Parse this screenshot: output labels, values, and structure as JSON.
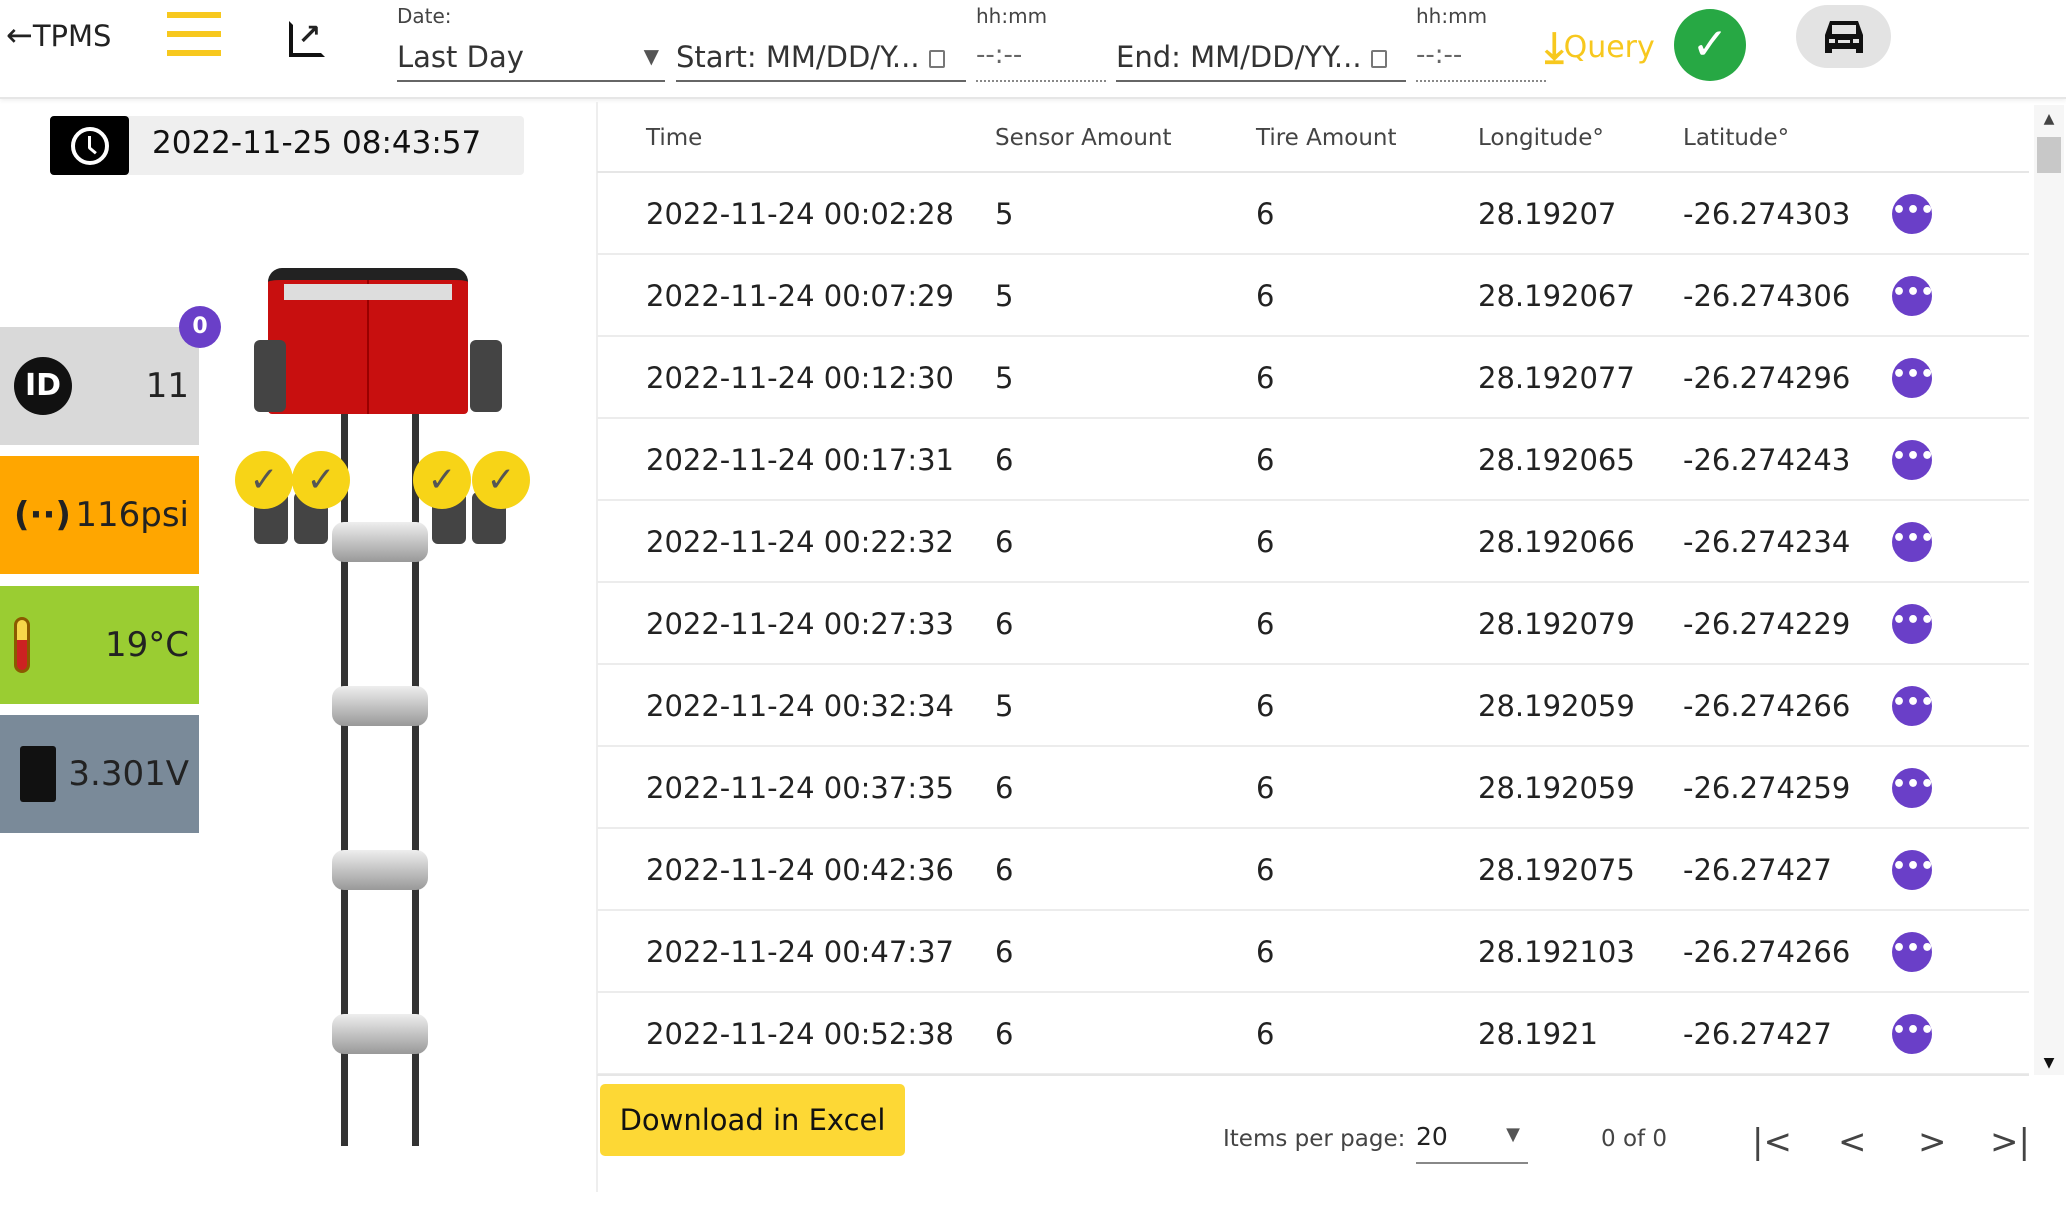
{
  "header": {
    "back_label": "TPMS",
    "date_label": "Date:",
    "date_value": "Last Day",
    "start_placeholder": "Start: MM/DD/Y...",
    "end_placeholder": "End: MM/DD/YY...",
    "time_label_start": "hh:mm",
    "time_label_end": "hh:mm",
    "time_placeholder": "--:--",
    "query_label": "Query",
    "accent": "#f7c81e",
    "confirm_color": "#27a844"
  },
  "status": {
    "timestamp": "2022-11-25 08:43:57",
    "badge": "0",
    "id": "11",
    "pressure": "116psi",
    "temperature": "19°C",
    "voltage": "3.301V",
    "colors": {
      "id": "#d9d9d9",
      "pressure": "#ffa600",
      "temperature": "#9acd32",
      "voltage": "#7a8a99"
    }
  },
  "diagram": {
    "tire_status": [
      "ok",
      "ok",
      "ok",
      "ok"
    ],
    "check_glyph": "✓"
  },
  "table": {
    "columns": [
      "Time",
      "Sensor Amount",
      "Tire Amount",
      "Longitude°",
      "Latitude°"
    ],
    "more_glyph": "•••",
    "rows": [
      [
        "2022-11-24 00:02:28",
        "5",
        "6",
        "28.19207",
        "-26.274303"
      ],
      [
        "2022-11-24 00:07:29",
        "5",
        "6",
        "28.192067",
        "-26.274306"
      ],
      [
        "2022-11-24 00:12:30",
        "5",
        "6",
        "28.192077",
        "-26.274296"
      ],
      [
        "2022-11-24 00:17:31",
        "6",
        "6",
        "28.192065",
        "-26.274243"
      ],
      [
        "2022-11-24 00:22:32",
        "6",
        "6",
        "28.192066",
        "-26.274234"
      ],
      [
        "2022-11-24 00:27:33",
        "6",
        "6",
        "28.192079",
        "-26.274229"
      ],
      [
        "2022-11-24 00:32:34",
        "5",
        "6",
        "28.192059",
        "-26.274266"
      ],
      [
        "2022-11-24 00:37:35",
        "6",
        "6",
        "28.192059",
        "-26.274259"
      ],
      [
        "2022-11-24 00:42:36",
        "6",
        "6",
        "28.192075",
        "-26.27427"
      ],
      [
        "2022-11-24 00:47:37",
        "6",
        "6",
        "28.192103",
        "-26.274266"
      ],
      [
        "2022-11-24 00:52:38",
        "6",
        "6",
        "28.1921",
        "-26.27427"
      ]
    ]
  },
  "footer": {
    "download_label": "Download in Excel",
    "items_per_page_label": "Items per page:",
    "items_per_page": "20",
    "range": "0 of 0",
    "first": "|<",
    "prev": "<",
    "next": ">",
    "last": ">|"
  }
}
